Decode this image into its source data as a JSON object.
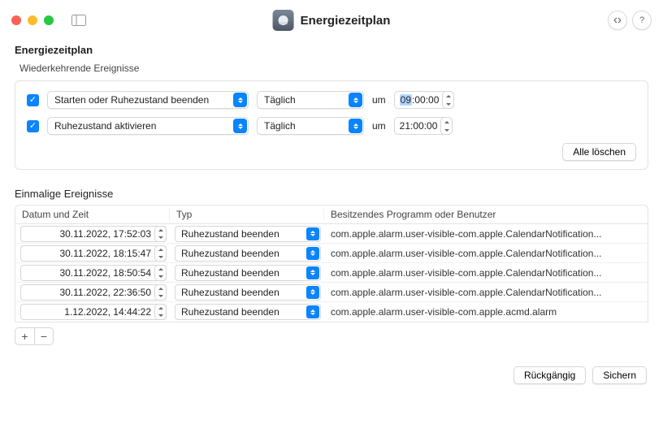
{
  "window": {
    "title": "Energiezeitplan"
  },
  "section": {
    "heading": "Energiezeitplan",
    "recurring_label": "Wiederkehrende Ereignisse",
    "onetime_label": "Einmalige Ereignisse"
  },
  "recurring": {
    "rows": [
      {
        "checked": true,
        "action": "Starten oder Ruhezustand beenden",
        "freq": "Täglich",
        "at_label": "um",
        "time": "09:00:00",
        "time_sel": "09"
      },
      {
        "checked": true,
        "action": "Ruhezustand aktivieren",
        "freq": "Täglich",
        "at_label": "um",
        "time": "21:00:00"
      }
    ],
    "clear_all": "Alle löschen"
  },
  "table": {
    "headers": {
      "datetime": "Datum und Zeit",
      "type": "Typ",
      "owner": "Besitzendes Programm oder Benutzer"
    },
    "rows": [
      {
        "datetime": "30.11.2022, 17:52:03",
        "type": "Ruhezustand beenden",
        "owner": "com.apple.alarm.user-visible-com.apple.CalendarNotification..."
      },
      {
        "datetime": "30.11.2022, 18:15:47",
        "type": "Ruhezustand beenden",
        "owner": "com.apple.alarm.user-visible-com.apple.CalendarNotification..."
      },
      {
        "datetime": "30.11.2022, 18:50:54",
        "type": "Ruhezustand beenden",
        "owner": "com.apple.alarm.user-visible-com.apple.CalendarNotification..."
      },
      {
        "datetime": "30.11.2022, 22:36:50",
        "type": "Ruhezustand beenden",
        "owner": "com.apple.alarm.user-visible-com.apple.CalendarNotification..."
      },
      {
        "datetime": "1.12.2022, 14:44:22",
        "type": "Ruhezustand beenden",
        "owner": "com.apple.alarm.user-visible-com.apple.acmd.alarm"
      }
    ]
  },
  "footer": {
    "revert": "Rückgängig",
    "save": "Sichern"
  }
}
